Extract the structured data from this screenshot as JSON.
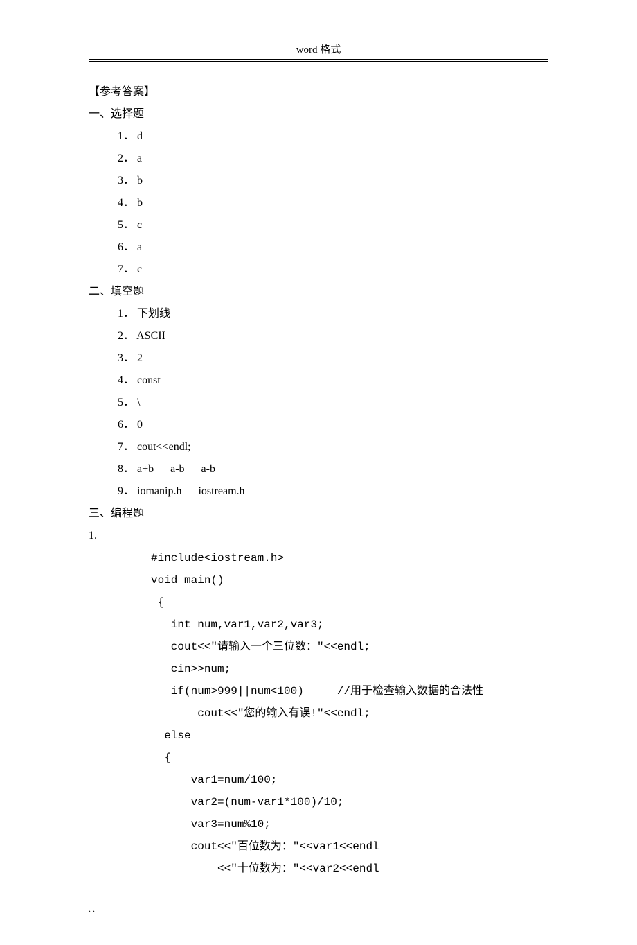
{
  "header": "word 格式",
  "title": "【参考答案】",
  "section1": {
    "heading": "一、选择题",
    "items": [
      "1． d",
      "2． a",
      "3． b",
      "4． b",
      "5． c",
      "6． a",
      "7． c"
    ]
  },
  "section2": {
    "heading": "二、填空题",
    "items": [
      "1． 下划线",
      "2． ASCII",
      "3． 2",
      "4． const",
      "5． \\",
      "6． 0",
      "7． cout<<endl;",
      "8． a+b      a-b      a-b",
      "9． iomanip.h      iostream.h"
    ]
  },
  "section3": {
    "heading": "三、编程题",
    "item_num": "1.",
    "code": [
      "#include<iostream.h>",
      "void main()",
      " {",
      "   int num,var1,var2,var3;",
      "   cout<<\"请输入一个三位数：\"<<endl;",
      "   cin>>num;",
      "   if(num>999||num<100)     //用于检查输入数据的合法性",
      "       cout<<\"您的输入有误!\"<<endl;",
      "  else",
      "  {",
      "      var1=num/100;",
      "      var2=(num-var1*100)/10;",
      "      var3=num%10;",
      "      cout<<\"百位数为：\"<<var1<<endl",
      "          <<\"十位数为：\"<<var2<<endl"
    ]
  },
  "footer": ". ."
}
